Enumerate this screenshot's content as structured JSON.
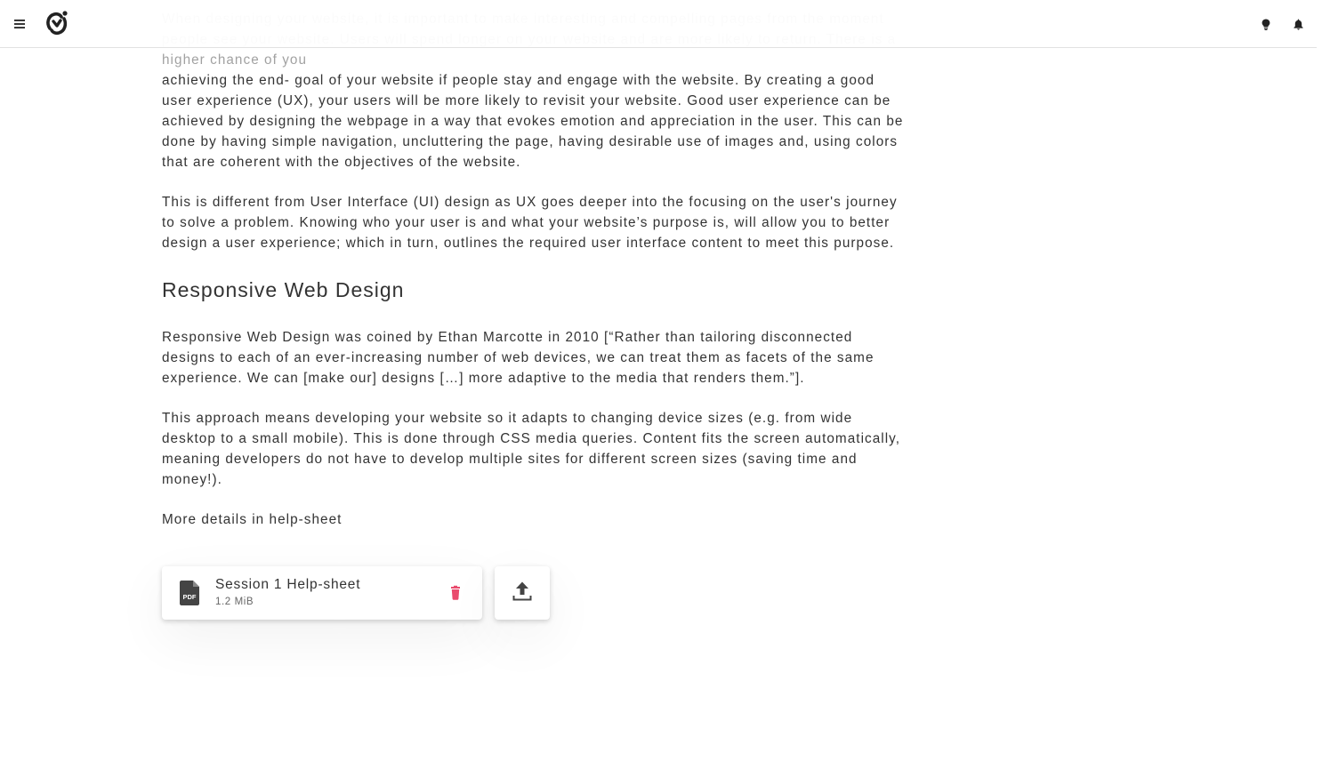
{
  "colors": {
    "accent_delete": "#e94b6d",
    "text": "#333333",
    "icon": "#222222"
  },
  "header": {
    "menu_icon": "hamburger-menu-icon",
    "logo_icon": "app-logo-icon",
    "right_icons": [
      "lightbulb-icon",
      "bell-icon"
    ]
  },
  "article": {
    "faded_intro": "When designing your website, it is important to make interesting and compelling pages from the moment people see your website. Users will spend longer on your website and are more likely to return. There is a higher chance of you",
    "paragraph1": "achieving the end- goal of your website if people stay and engage with the website. By creating a good user experience (UX), your users will be more likely to revisit your website. Good user experience can be achieved by designing the webpage in a way that evokes emotion and appreciation in the user. This can be done by having simple navigation, uncluttering the page, having desirable use of images and, using colors that are coherent with the objectives of the website.",
    "paragraph2": "This is different from User Interface (UI) design as UX goes deeper into the focusing on the user's journey to solve a problem. Knowing who your user is and what your website’s purpose is, will allow you to better design a user experience; which in turn, outlines the required user interface content to meet this purpose.",
    "heading": "Responsive Web Design",
    "paragraph3": "Responsive Web Design was coined by Ethan Marcotte in 2010 [“Rather than tailoring disconnected designs to each of an ever-increasing number of web devices, we can treat them as facets of the same experience. We can [make our] designs […] more adaptive to the media that renders them.”].",
    "paragraph4": "This approach means developing your website so it adapts to changing device sizes (e.g. from wide desktop to a small mobile). This is done through CSS media queries. Content fits the screen automatically, meaning developers do not have to develop multiple sites for different screen sizes (saving time and money!).",
    "paragraph5": "More details in help-sheet"
  },
  "attachment": {
    "icon": "pdf-file-icon",
    "name": "Session 1 Help-sheet",
    "size": "1.2 MiB",
    "delete_icon": "trash-icon"
  },
  "upload": {
    "icon": "upload-icon"
  }
}
